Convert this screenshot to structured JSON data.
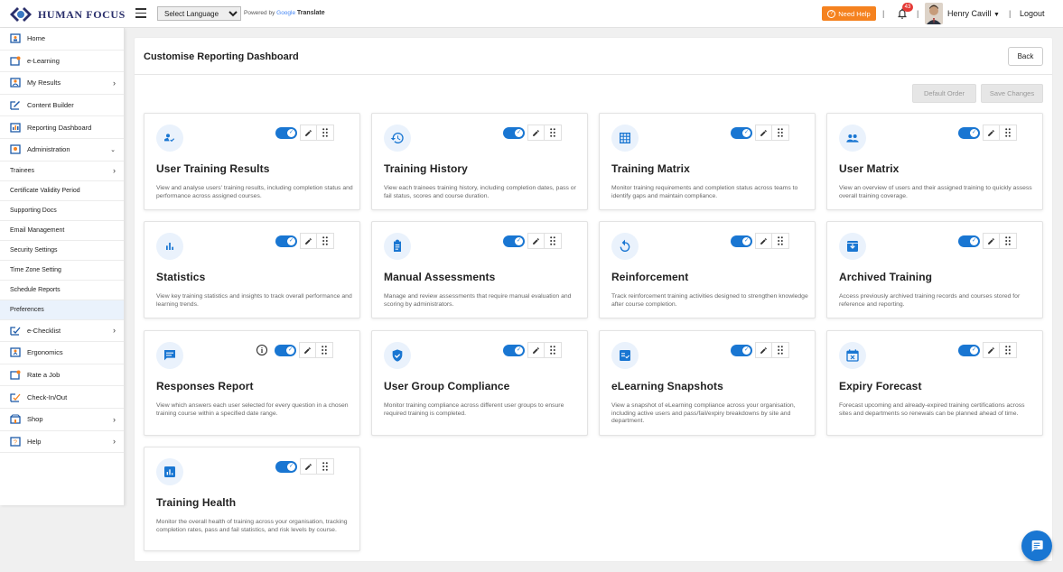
{
  "header": {
    "brand": "HUMAN FOCUS",
    "language_select": "Select Language",
    "powered_by": "Powered by",
    "google": "Google",
    "translate": "Translate",
    "need_help": "Need Help",
    "notification_count": "43",
    "user_name": "Henry Cavill",
    "logout": "Logout",
    "accent_color": "#f5821f"
  },
  "sidebar": {
    "items": [
      {
        "label": "Home",
        "icon": "home-icon"
      },
      {
        "label": "e-Learning",
        "icon": "elearning-icon"
      },
      {
        "label": "My Results",
        "icon": "results-icon",
        "chevron": ">"
      },
      {
        "label": "Content Builder",
        "icon": "edit-icon"
      },
      {
        "label": "Reporting Dashboard",
        "icon": "dashboard-icon"
      },
      {
        "label": "Administration",
        "icon": "admin-icon",
        "chevron": "v"
      }
    ],
    "admin_items": [
      {
        "label": "Trainees",
        "chevron": ">"
      },
      {
        "label": "Certificate Validity Period"
      },
      {
        "label": "Supporting Docs"
      },
      {
        "label": "Email Management"
      },
      {
        "label": "Security Settings"
      },
      {
        "label": "Time Zone Setting"
      },
      {
        "label": "Schedule Reports"
      },
      {
        "label": "Preferences"
      }
    ],
    "bottom_items": [
      {
        "label": "e-Checklist",
        "icon": "checklist-icon",
        "chevron": ">"
      },
      {
        "label": "Ergonomics",
        "icon": "ergonomics-icon"
      },
      {
        "label": "Rate a Job",
        "icon": "rate-icon"
      },
      {
        "label": "Check-In/Out",
        "icon": "checkin-icon"
      },
      {
        "label": "Shop",
        "icon": "shop-icon",
        "chevron": ">"
      },
      {
        "label": "Help",
        "icon": "help-icon",
        "chevron": ">"
      }
    ]
  },
  "main": {
    "title": "Customise Reporting Dashboard",
    "back": "Back",
    "default_order": "Default Order",
    "save_changes": "Save Changes",
    "cards": [
      {
        "title": "User Training Results",
        "desc": "View and analyse users' training results, including completion status and performance across assigned courses.",
        "icon": "user-check-icon"
      },
      {
        "title": "Training History",
        "desc": "View each trainees training history, including completion dates, pass or fail status, scores and course duration.",
        "icon": "history-icon"
      },
      {
        "title": "Training Matrix",
        "desc": "Monitor training requirements and completion status across teams to identify gaps and maintain compliance.",
        "icon": "grid-icon"
      },
      {
        "title": "User Matrix",
        "desc": "View an overview of users and their assigned training to quickly assess overall training coverage.",
        "icon": "users-icon"
      },
      {
        "title": "Statistics",
        "desc": "View key training statistics and insights to track overall performance and learning trends.",
        "icon": "bar-chart-icon"
      },
      {
        "title": "Manual Assessments",
        "desc": "Manage and review assessments that require manual evaluation and scoring by administrators.",
        "icon": "clipboard-icon"
      },
      {
        "title": "Reinforcement",
        "desc": "Track reinforcement training activities designed to strengthen knowledge after course completion.",
        "icon": "refresh-icon"
      },
      {
        "title": "Archived Training",
        "desc": "Access previously archived training records and courses stored for reference and reporting.",
        "icon": "archive-icon"
      },
      {
        "title": "Responses Report",
        "desc": "View which answers each user selected for every question in a chosen training course within a specified date range.",
        "icon": "chat-icon",
        "info": "i"
      },
      {
        "title": "User Group Compliance",
        "desc": "Monitor training compliance across different user groups to ensure required training is completed.",
        "icon": "shield-check-icon"
      },
      {
        "title": "eLearning Snapshots",
        "desc": "View a snapshot of eLearning compliance across your organisation, including active users and pass/fail/expiry breakdowns by site and department.",
        "icon": "list-check-icon"
      },
      {
        "title": "Expiry Forecast",
        "desc": "Forecast upcoming and already-expired training certifications across sites and departments so renewals can be planned ahead of time.",
        "icon": "calendar-x-icon"
      },
      {
        "title": "Training Health",
        "desc": "Monitor the overall health of training across your organisation, tracking completion rates, pass and fail statistics, and risk levels by course.",
        "icon": "health-chart-icon"
      }
    ]
  }
}
